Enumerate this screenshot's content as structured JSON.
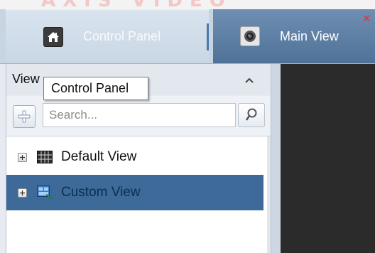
{
  "watermark": "AXIS VIDEO",
  "tabs": {
    "control_panel": {
      "label": "Control Panel",
      "icon": "home-icon"
    },
    "main_view": {
      "label": "Main View",
      "icon": "camera-icon",
      "close": "×"
    }
  },
  "left_panel": {
    "title": "View",
    "tooltip": "Control Panel",
    "search": {
      "placeholder": "Search..."
    },
    "tree": [
      {
        "label": "Default View",
        "icon": "grid-view-icon",
        "selected": false
      },
      {
        "label": "Custom View",
        "icon": "custom-view-icon",
        "selected": true
      }
    ]
  },
  "colors": {
    "selection": "#3d6a98",
    "active_tab": "#5a7da3",
    "view_background": "#2b2b2b"
  }
}
